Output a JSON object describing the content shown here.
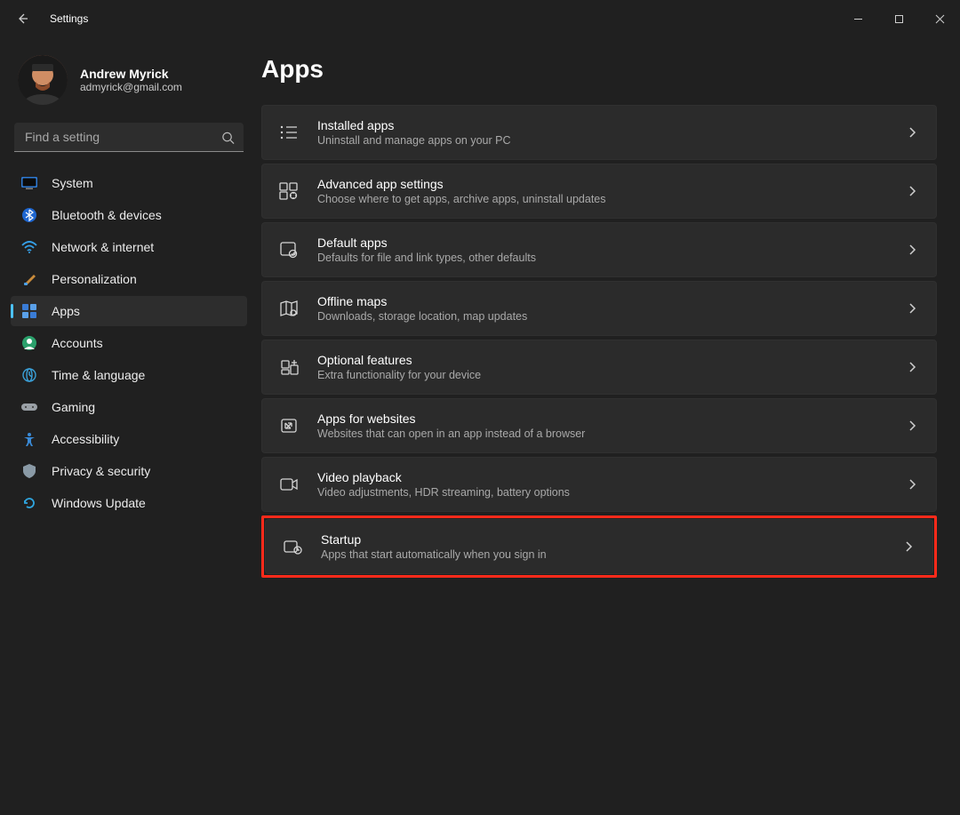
{
  "window": {
    "title": "Settings"
  },
  "profile": {
    "name": "Andrew Myrick",
    "email": "admyrick@gmail.com"
  },
  "search": {
    "placeholder": "Find a setting"
  },
  "nav": {
    "items": [
      {
        "id": "system",
        "label": "System"
      },
      {
        "id": "bluetooth",
        "label": "Bluetooth & devices"
      },
      {
        "id": "network",
        "label": "Network & internet"
      },
      {
        "id": "personalization",
        "label": "Personalization"
      },
      {
        "id": "apps",
        "label": "Apps"
      },
      {
        "id": "accounts",
        "label": "Accounts"
      },
      {
        "id": "time-language",
        "label": "Time & language"
      },
      {
        "id": "gaming",
        "label": "Gaming"
      },
      {
        "id": "accessibility",
        "label": "Accessibility"
      },
      {
        "id": "privacy-security",
        "label": "Privacy & security"
      },
      {
        "id": "windows-update",
        "label": "Windows Update"
      }
    ],
    "activeIndex": 4
  },
  "page": {
    "title": "Apps",
    "items": [
      {
        "id": "installed-apps",
        "title": "Installed apps",
        "sub": "Uninstall and manage apps on your PC"
      },
      {
        "id": "advanced-settings",
        "title": "Advanced app settings",
        "sub": "Choose where to get apps, archive apps, uninstall updates"
      },
      {
        "id": "default-apps",
        "title": "Default apps",
        "sub": "Defaults for file and link types, other defaults"
      },
      {
        "id": "offline-maps",
        "title": "Offline maps",
        "sub": "Downloads, storage location, map updates"
      },
      {
        "id": "optional-features",
        "title": "Optional features",
        "sub": "Extra functionality for your device"
      },
      {
        "id": "apps-for-websites",
        "title": "Apps for websites",
        "sub": "Websites that can open in an app instead of a browser"
      },
      {
        "id": "video-playback",
        "title": "Video playback",
        "sub": "Video adjustments, HDR streaming, battery options"
      },
      {
        "id": "startup",
        "title": "Startup",
        "sub": "Apps that start automatically when you sign in",
        "highlighted": true
      }
    ]
  },
  "colors": {
    "accent": "#4cc2ff",
    "highlight": "#ff2a1a",
    "panel": "#2b2b2b",
    "bg": "#202020"
  }
}
